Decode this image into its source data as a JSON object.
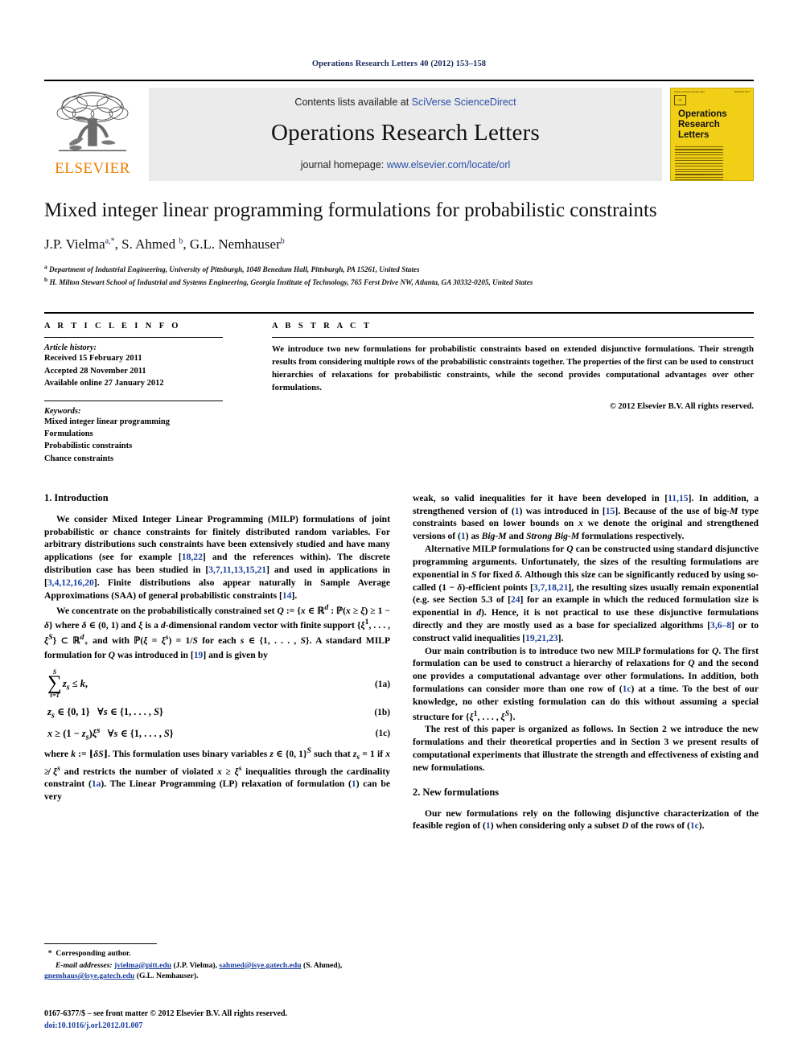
{
  "running_head": "Operations Research Letters 40 (2012) 153–158",
  "masthead": {
    "publisher_name": "ELSEVIER",
    "contents_prefix": "Contents lists available at ",
    "contents_link": "SciVerse ScienceDirect",
    "journal_title": "Operations Research Letters",
    "homepage_prefix": "journal homepage: ",
    "homepage_link": "www.elsevier.com/locate/orl"
  },
  "cover": {
    "volume_line": "Volume 40  Issue 3  January 2012",
    "issn_line": "ISSN 0167-6377",
    "badge_text": "ORL",
    "title_line1": "Operations",
    "title_line2": "Research",
    "title_line3": "Letters",
    "footer": "www.elsevier.com/locate/orl"
  },
  "article": {
    "title": "Mixed integer linear programming formulations for probabilistic constraints",
    "authors": [
      {
        "name": "J.P. Vielma",
        "sup": "a,",
        "star": "*"
      },
      {
        "name": "S. Ahmed",
        "sup": "b"
      },
      {
        "name": "G.L. Nemhauser",
        "sup": "b"
      }
    ],
    "affiliations": [
      {
        "mark": "a",
        "text": "Department of Industrial Engineering, University of Pittsburgh, 1048 Benedum Hall, Pittsburgh, PA 15261, United States"
      },
      {
        "mark": "b",
        "text": "H. Milton Stewart School of Industrial and Systems Engineering, Georgia Institute of Technology, 765 Ferst Drive NW, Atlanta, GA 30332-0205, United States"
      }
    ]
  },
  "info": {
    "heading": "A R T I C L E    I N F O",
    "history_label": "Article history:",
    "history": [
      "Received 15 February 2011",
      "Accepted 28 November 2011",
      "Available online 27 January 2012"
    ],
    "keywords_label": "Keywords:",
    "keywords": [
      "Mixed integer linear programming",
      "Formulations",
      "Probabilistic constraints",
      "Chance constraints"
    ]
  },
  "abstract": {
    "heading": "A B S T R A C T",
    "text": "We introduce two new formulations for probabilistic constraints based on extended disjunctive formulations. Their strength results from considering multiple rows of the probabilistic constraints together. The properties of the first can be used to construct hierarchies of relaxations for probabilistic constraints, while the second provides computational advantages over other formulations.",
    "copyright": "© 2012 Elsevier B.V. All rights reserved."
  },
  "sections": {
    "intro_heading": "1.  Introduction",
    "new_formulations_heading": "2.  New formulations"
  },
  "equations": [
    {
      "tag": "(1a)"
    },
    {
      "tag": "(1b)"
    },
    {
      "tag": "(1c)"
    }
  ],
  "footnote": {
    "corresponding": "Corresponding author.",
    "email_label": "E-mail addresses:",
    "emails": [
      {
        "addr": "jvielma@pitt.edu",
        "who": "(J.P. Vielma)"
      },
      {
        "addr": "sahmed@isye.gatech.edu",
        "who": "(S. Ahmed)"
      },
      {
        "addr": "gnemhaus@isye.gatech.edu",
        "who": "(G.L. Nemhauser)"
      }
    ]
  },
  "imprint": {
    "line1": "0167-6377/$ – see front matter © 2012 Elsevier B.V. All rights reserved.",
    "doi": "doi:10.1016/j.orl.2012.01.007"
  },
  "colors": {
    "link_blue": "#2a4ea8",
    "cite_blue": "#1a3fa0",
    "elsevier_orange": "#F07D00",
    "cover_yellow": "#F2CF17",
    "banner_gray": "#ebebeb"
  }
}
